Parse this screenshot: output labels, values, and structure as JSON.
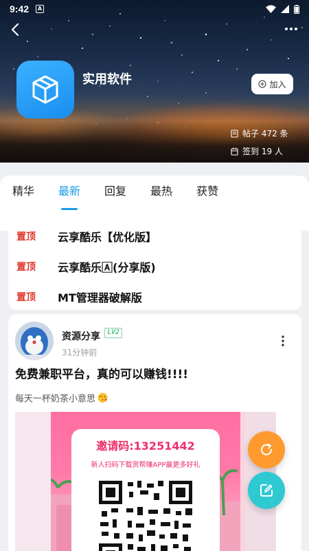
{
  "status_bar": {
    "time": "9:42",
    "notification_icon": "a-badge-icon"
  },
  "header": {
    "group_name": "实用软件",
    "join_label": "加入",
    "posts_stat": "帖子 472 条",
    "checkin_stat": "签到 19 人"
  },
  "tabs": [
    {
      "label": "精华",
      "active": false
    },
    {
      "label": "最新",
      "active": true
    },
    {
      "label": "回复",
      "active": false
    },
    {
      "label": "最热",
      "active": false
    },
    {
      "label": "获赞",
      "active": false
    }
  ],
  "pinned": [
    {
      "badge": "置顶",
      "title": "云享酷乐【优化版】"
    },
    {
      "badge": "置顶",
      "title": "云享酷乐🄰(分享版)"
    },
    {
      "badge": "置顶",
      "title": "MT管理器破解版"
    }
  ],
  "post": {
    "author": "资源分享",
    "level": "LV2",
    "time": "31分钟前",
    "title": "免费兼职平台，真的可以赚钱!!!!",
    "excerpt": "每天一杯奶茶小意思",
    "poster": {
      "invite_code": "邀请码:13251442",
      "invite_sub": "新人扫码下载赏帮赚APP赢更多好礼"
    }
  },
  "colors": {
    "accent": "#1a9be8",
    "pin_red": "#e0352b",
    "fab_refresh": "#ff9a2e",
    "fab_edit": "#2fc9d2",
    "app_icon": "#2a9ff8"
  }
}
